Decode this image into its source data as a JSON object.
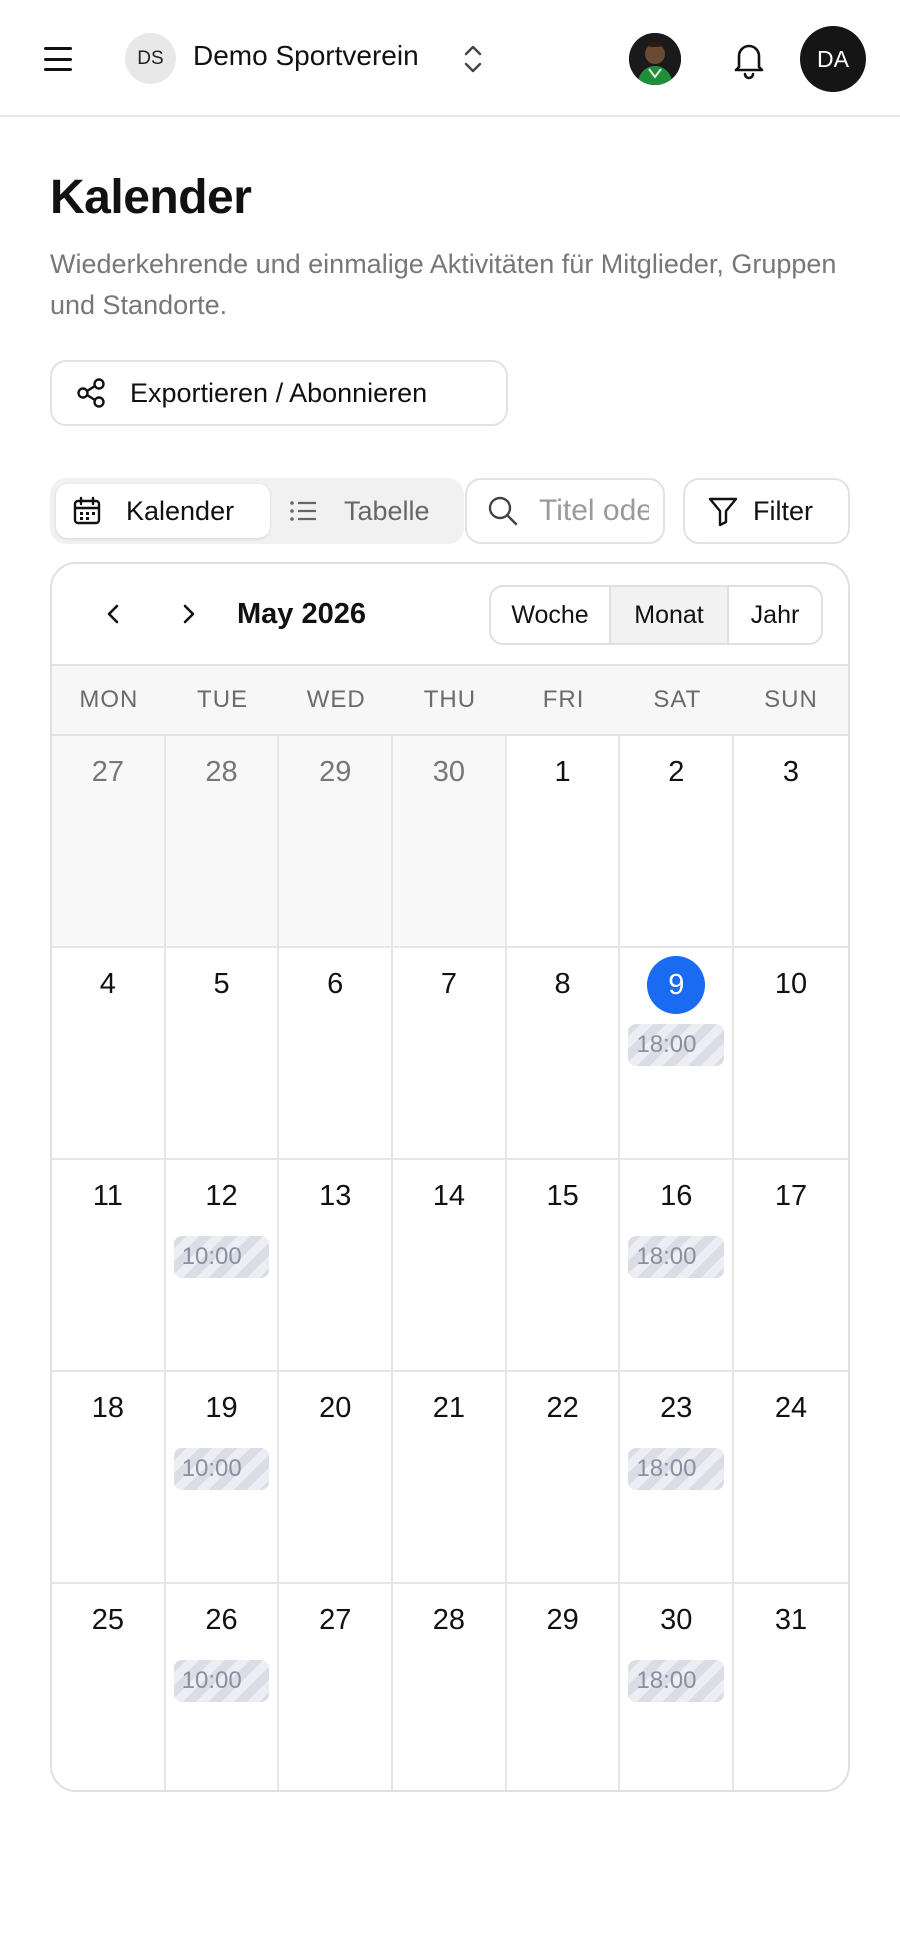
{
  "header": {
    "org_initials": "DS",
    "org_name": "Demo Sportverein",
    "user_initials": "DA"
  },
  "page": {
    "title": "Kalender",
    "description": "Wiederkehrende und einmalige Aktivitäten für Mitglieder, Gruppen und Standorte.",
    "export_label": "Exportieren / Abonnieren"
  },
  "toolbar": {
    "view_calendar": "Kalender",
    "view_table": "Tabelle",
    "search_placeholder": "Titel oder Ort suchen",
    "filter_label": "Filter"
  },
  "calendar": {
    "month_label": "May 2026",
    "ranges": [
      "Woche",
      "Monat",
      "Jahr"
    ],
    "selected_range": "Monat",
    "weekdays": [
      "MON",
      "TUE",
      "WED",
      "THU",
      "FRI",
      "SAT",
      "SUN"
    ],
    "today": 9,
    "today_color": "#1a6af2",
    "weeks": [
      [
        {
          "d": "27",
          "out": true
        },
        {
          "d": "28",
          "out": true
        },
        {
          "d": "29",
          "out": true
        },
        {
          "d": "30",
          "out": true
        },
        {
          "d": "1"
        },
        {
          "d": "2"
        },
        {
          "d": "3"
        }
      ],
      [
        {
          "d": "4"
        },
        {
          "d": "5"
        },
        {
          "d": "6"
        },
        {
          "d": "7"
        },
        {
          "d": "8"
        },
        {
          "d": "9",
          "today": true,
          "event": "18:00"
        },
        {
          "d": "10"
        }
      ],
      [
        {
          "d": "11"
        },
        {
          "d": "12",
          "event": "10:00"
        },
        {
          "d": "13"
        },
        {
          "d": "14"
        },
        {
          "d": "15"
        },
        {
          "d": "16",
          "event": "18:00"
        },
        {
          "d": "17"
        }
      ],
      [
        {
          "d": "18"
        },
        {
          "d": "19",
          "event": "10:00"
        },
        {
          "d": "20"
        },
        {
          "d": "21"
        },
        {
          "d": "22"
        },
        {
          "d": "23",
          "event": "18:00"
        },
        {
          "d": "24"
        }
      ],
      [
        {
          "d": "25"
        },
        {
          "d": "26",
          "event": "10:00"
        },
        {
          "d": "27"
        },
        {
          "d": "28"
        },
        {
          "d": "29"
        },
        {
          "d": "30",
          "event": "18:00"
        },
        {
          "d": "31"
        }
      ]
    ]
  }
}
